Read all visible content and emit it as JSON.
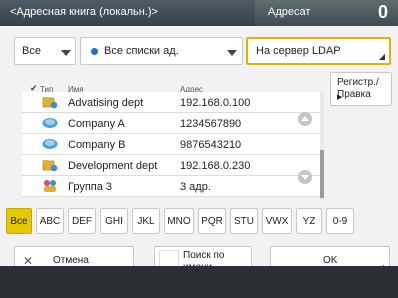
{
  "header": {
    "title": "<Адресная книга (локальн.)>",
    "recipient_label": "Адресат",
    "recipient_count": "0"
  },
  "filters": {
    "type_value": "Все",
    "list_value": "Все списки ад.",
    "ldap_button": "На сервер LDAP"
  },
  "columns": {
    "type": "Тип",
    "name": "Имя",
    "address": "Адрес"
  },
  "entries": [
    {
      "name": "Advatising dept",
      "address": "192.168.0.100",
      "icon": "folder-network-icon"
    },
    {
      "name": "Company A",
      "address": "1234567890",
      "icon": "fax-icon"
    },
    {
      "name": "Company B",
      "address": "9876543210",
      "icon": "fax-icon"
    },
    {
      "name": "Development dept",
      "address": "192.168.0.230",
      "icon": "folder-network-icon"
    },
    {
      "name": "Группа 3",
      "address": "3 адр.",
      "icon": "group-icon"
    }
  ],
  "register_button": {
    "line1": "Регистр./",
    "line2": "Правка"
  },
  "alphabet": [
    "Все",
    "ABC",
    "DEF",
    "GHI",
    "JKL",
    "MNO",
    "PQR",
    "STU",
    "VWX",
    "YZ",
    "0-9"
  ],
  "bottom": {
    "cancel": "Отмена",
    "search_line1": "Поиск по",
    "search_line2": "имени",
    "ok": "OK"
  },
  "colors": {
    "accent": "#e6c800",
    "header": "#3b4650"
  }
}
